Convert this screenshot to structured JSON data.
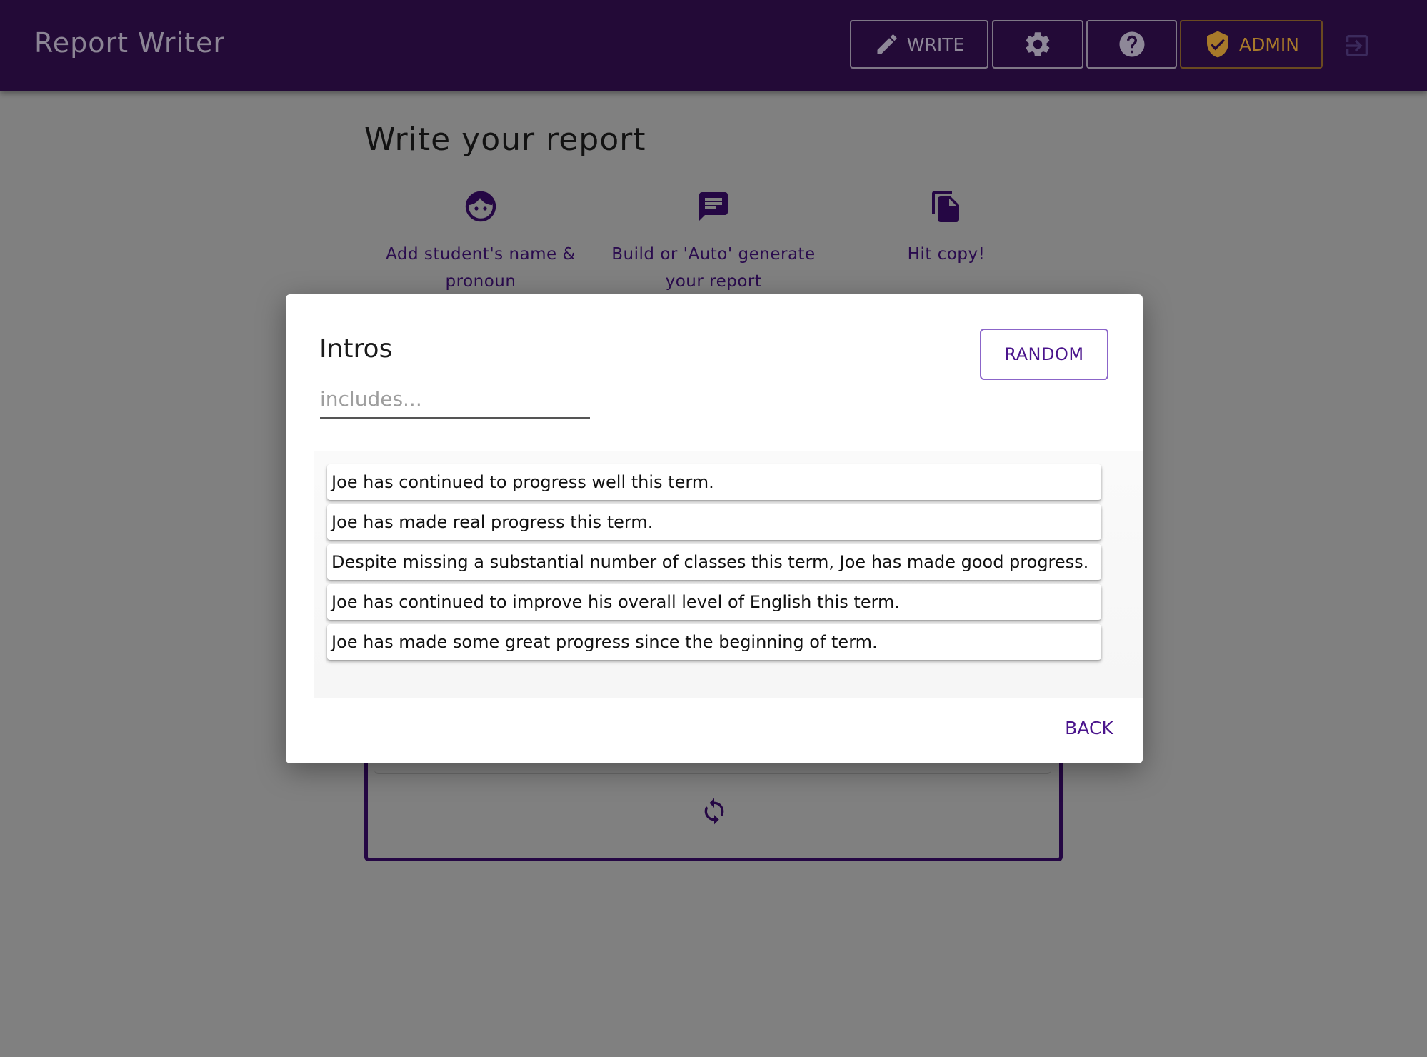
{
  "header": {
    "app_title": "Report Writer",
    "write_label": "WRITE",
    "admin_label": "ADMIN",
    "icons": {
      "write": "pencil-icon",
      "settings": "gear-icon",
      "help": "help-icon",
      "admin": "shield-check-icon",
      "logout": "logout-icon"
    }
  },
  "page": {
    "title": "Write your report",
    "steps": [
      {
        "label": "Add student's name & pronoun",
        "icon": "face-icon"
      },
      {
        "label": "Build or 'Auto' generate your report",
        "icon": "message-icon"
      },
      {
        "label": "Hit copy!",
        "icon": "copy-icon"
      }
    ],
    "refresh_icon": "refresh-icon"
  },
  "modal": {
    "title": "Intros",
    "random_label": "RANDOM",
    "search_placeholder": "includes...",
    "search_value": "",
    "items": [
      "Joe has continued to progress well this term.",
      "Joe has made real progress this term.",
      "Despite missing a substantial number of classes this term, Joe has made good progress.",
      "Joe has continued to improve his overall level of English this term.",
      "Joe has made some great progress since the beginning of term."
    ],
    "back_label": "BACK"
  },
  "colors": {
    "header_bg": "#230a37",
    "overlay": "#808080",
    "accent_purple": "#4a148c",
    "admin_orange": "#a87a2a"
  }
}
